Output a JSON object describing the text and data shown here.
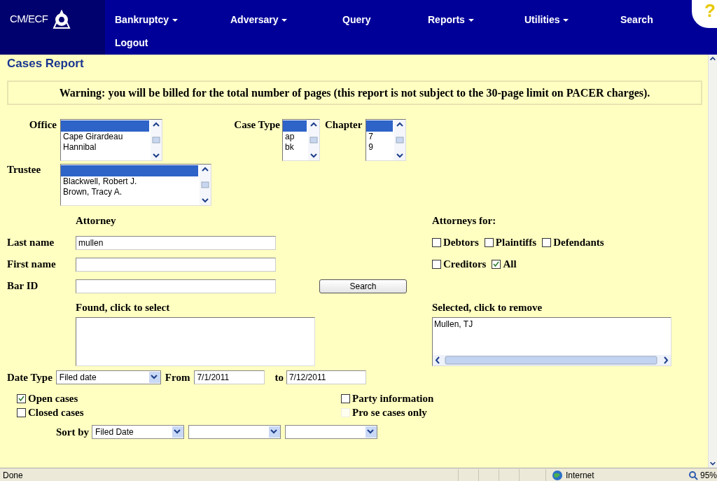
{
  "nav": {
    "logo": "CM/ECF",
    "help": "?",
    "menu": [
      {
        "label": "Bankruptcy",
        "dropdown": true
      },
      {
        "label": "Adversary",
        "dropdown": true
      },
      {
        "label": "Query",
        "dropdown": false
      },
      {
        "label": "Reports",
        "dropdown": true
      },
      {
        "label": "Utilities",
        "dropdown": true
      },
      {
        "label": "Search",
        "dropdown": false
      },
      {
        "label": "Logout",
        "dropdown": false
      }
    ]
  },
  "title": "Cases Report",
  "warning": "Warning: you will be billed for the total number of pages (this report is not subject to the 30-page limit on PACER charges).",
  "filters": [
    {
      "label": "Office",
      "blank_selected": true,
      "options": [
        "Cape Girardeau",
        "Hannibal"
      ]
    },
    {
      "label": "Case Type",
      "blank_selected": true,
      "options": [
        "ap",
        "bk"
      ]
    },
    {
      "label": "Chapter",
      "blank_selected": true,
      "options": [
        "7",
        "9"
      ]
    },
    {
      "label": "Trustee",
      "blank_selected": true,
      "options": [
        "Blackwell, Robert J.",
        "Brown, Tracy A."
      ]
    }
  ],
  "attorney": {
    "heading": "Attorney",
    "fields": [
      {
        "label": "Last name",
        "value": "mullen"
      },
      {
        "label": "First name"
      },
      {
        "label": "Bar ID"
      }
    ],
    "search_button": "Search",
    "found_label": "Found, click to select",
    "selected_label": "Selected, click to remove",
    "selected_items": [
      "Mullen, TJ"
    ]
  },
  "attorneys_for": {
    "heading": "Attorneys for:",
    "rows": [
      [
        {
          "label": "Debtors",
          "checked": false
        },
        {
          "label": "Plaintiffs",
          "checked": false
        },
        {
          "label": "Defendants",
          "checked": false
        }
      ],
      [
        {
          "label": "Creditors",
          "checked": false
        },
        {
          "label": "All",
          "checked": true
        }
      ]
    ]
  },
  "date": {
    "label": "Date Type",
    "type": "Filed date",
    "from_label": "From",
    "from": "7/1/2011",
    "to_label": "to",
    "to": "7/12/2011"
  },
  "case_options": [
    {
      "label": "Open cases",
      "checked": true,
      "disabled": false
    },
    {
      "label": "Closed cases",
      "checked": false,
      "disabled": false
    }
  ],
  "extra_options": [
    {
      "label": "Party information",
      "checked": false,
      "disabled": false
    },
    {
      "label": "Pro se cases only",
      "checked": false,
      "disabled": true
    }
  ],
  "sort": {
    "label": "Sort by",
    "selects": [
      {
        "kind": "filled",
        "value": "Filed Date"
      },
      {
        "kind": "empty"
      },
      {
        "kind": "empty"
      }
    ]
  },
  "status_bar": {
    "text": "Done",
    "zone": "Internet",
    "zoom": "95%"
  }
}
